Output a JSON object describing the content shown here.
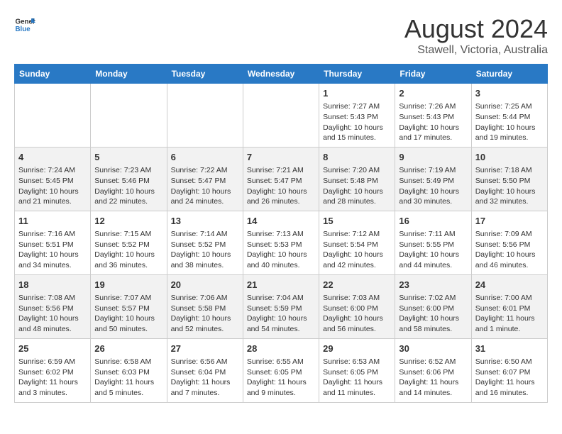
{
  "logo": {
    "line1": "General",
    "line2": "Blue"
  },
  "title": "August 2024",
  "subtitle": "Stawell, Victoria, Australia",
  "days_of_week": [
    "Sunday",
    "Monday",
    "Tuesday",
    "Wednesday",
    "Thursday",
    "Friday",
    "Saturday"
  ],
  "weeks": [
    [
      {
        "day": "",
        "info": ""
      },
      {
        "day": "",
        "info": ""
      },
      {
        "day": "",
        "info": ""
      },
      {
        "day": "",
        "info": ""
      },
      {
        "day": "1",
        "info": "Sunrise: 7:27 AM\nSunset: 5:43 PM\nDaylight: 10 hours\nand 15 minutes."
      },
      {
        "day": "2",
        "info": "Sunrise: 7:26 AM\nSunset: 5:43 PM\nDaylight: 10 hours\nand 17 minutes."
      },
      {
        "day": "3",
        "info": "Sunrise: 7:25 AM\nSunset: 5:44 PM\nDaylight: 10 hours\nand 19 minutes."
      }
    ],
    [
      {
        "day": "4",
        "info": "Sunrise: 7:24 AM\nSunset: 5:45 PM\nDaylight: 10 hours\nand 21 minutes."
      },
      {
        "day": "5",
        "info": "Sunrise: 7:23 AM\nSunset: 5:46 PM\nDaylight: 10 hours\nand 22 minutes."
      },
      {
        "day": "6",
        "info": "Sunrise: 7:22 AM\nSunset: 5:47 PM\nDaylight: 10 hours\nand 24 minutes."
      },
      {
        "day": "7",
        "info": "Sunrise: 7:21 AM\nSunset: 5:47 PM\nDaylight: 10 hours\nand 26 minutes."
      },
      {
        "day": "8",
        "info": "Sunrise: 7:20 AM\nSunset: 5:48 PM\nDaylight: 10 hours\nand 28 minutes."
      },
      {
        "day": "9",
        "info": "Sunrise: 7:19 AM\nSunset: 5:49 PM\nDaylight: 10 hours\nand 30 minutes."
      },
      {
        "day": "10",
        "info": "Sunrise: 7:18 AM\nSunset: 5:50 PM\nDaylight: 10 hours\nand 32 minutes."
      }
    ],
    [
      {
        "day": "11",
        "info": "Sunrise: 7:16 AM\nSunset: 5:51 PM\nDaylight: 10 hours\nand 34 minutes."
      },
      {
        "day": "12",
        "info": "Sunrise: 7:15 AM\nSunset: 5:52 PM\nDaylight: 10 hours\nand 36 minutes."
      },
      {
        "day": "13",
        "info": "Sunrise: 7:14 AM\nSunset: 5:52 PM\nDaylight: 10 hours\nand 38 minutes."
      },
      {
        "day": "14",
        "info": "Sunrise: 7:13 AM\nSunset: 5:53 PM\nDaylight: 10 hours\nand 40 minutes."
      },
      {
        "day": "15",
        "info": "Sunrise: 7:12 AM\nSunset: 5:54 PM\nDaylight: 10 hours\nand 42 minutes."
      },
      {
        "day": "16",
        "info": "Sunrise: 7:11 AM\nSunset: 5:55 PM\nDaylight: 10 hours\nand 44 minutes."
      },
      {
        "day": "17",
        "info": "Sunrise: 7:09 AM\nSunset: 5:56 PM\nDaylight: 10 hours\nand 46 minutes."
      }
    ],
    [
      {
        "day": "18",
        "info": "Sunrise: 7:08 AM\nSunset: 5:56 PM\nDaylight: 10 hours\nand 48 minutes."
      },
      {
        "day": "19",
        "info": "Sunrise: 7:07 AM\nSunset: 5:57 PM\nDaylight: 10 hours\nand 50 minutes."
      },
      {
        "day": "20",
        "info": "Sunrise: 7:06 AM\nSunset: 5:58 PM\nDaylight: 10 hours\nand 52 minutes."
      },
      {
        "day": "21",
        "info": "Sunrise: 7:04 AM\nSunset: 5:59 PM\nDaylight: 10 hours\nand 54 minutes."
      },
      {
        "day": "22",
        "info": "Sunrise: 7:03 AM\nSunset: 6:00 PM\nDaylight: 10 hours\nand 56 minutes."
      },
      {
        "day": "23",
        "info": "Sunrise: 7:02 AM\nSunset: 6:00 PM\nDaylight: 10 hours\nand 58 minutes."
      },
      {
        "day": "24",
        "info": "Sunrise: 7:00 AM\nSunset: 6:01 PM\nDaylight: 11 hours\nand 1 minute."
      }
    ],
    [
      {
        "day": "25",
        "info": "Sunrise: 6:59 AM\nSunset: 6:02 PM\nDaylight: 11 hours\nand 3 minutes."
      },
      {
        "day": "26",
        "info": "Sunrise: 6:58 AM\nSunset: 6:03 PM\nDaylight: 11 hours\nand 5 minutes."
      },
      {
        "day": "27",
        "info": "Sunrise: 6:56 AM\nSunset: 6:04 PM\nDaylight: 11 hours\nand 7 minutes."
      },
      {
        "day": "28",
        "info": "Sunrise: 6:55 AM\nSunset: 6:05 PM\nDaylight: 11 hours\nand 9 minutes."
      },
      {
        "day": "29",
        "info": "Sunrise: 6:53 AM\nSunset: 6:05 PM\nDaylight: 11 hours\nand 11 minutes."
      },
      {
        "day": "30",
        "info": "Sunrise: 6:52 AM\nSunset: 6:06 PM\nDaylight: 11 hours\nand 14 minutes."
      },
      {
        "day": "31",
        "info": "Sunrise: 6:50 AM\nSunset: 6:07 PM\nDaylight: 11 hours\nand 16 minutes."
      }
    ]
  ]
}
